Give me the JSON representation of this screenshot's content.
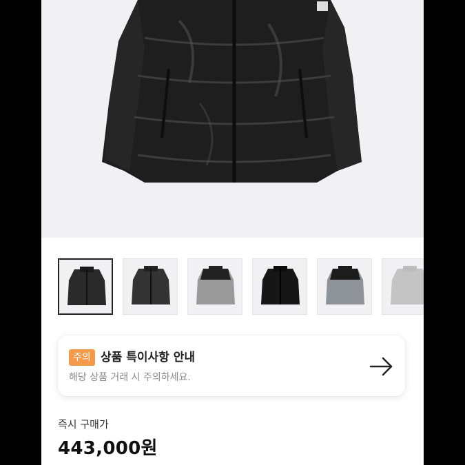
{
  "product": {
    "main_image": "black puffer down jacket",
    "thumbnails": [
      {
        "icon": "black-jacket",
        "color": "#2a2a2a",
        "accent": "#1a1a1a",
        "selected": true
      },
      {
        "icon": "black-jacket",
        "color": "#333333",
        "accent": "#222222",
        "selected": false
      },
      {
        "icon": "grey-black-jacket",
        "color": "#9a9a9a",
        "accent": "#222222",
        "selected": false
      },
      {
        "icon": "black-jacket",
        "color": "#161616",
        "accent": "#0e0e0e",
        "selected": false
      },
      {
        "icon": "grey-black-jacket",
        "color": "#8e939a",
        "accent": "#1c1c1c",
        "selected": false
      },
      {
        "icon": "silver-jacket",
        "color": "#c4c4c4",
        "accent": "#bdbdbd",
        "selected": false
      }
    ]
  },
  "notice": {
    "badge": "주의",
    "title": "상품 특이사항 안내",
    "subtitle": "해당 상품 거래 시 주의하세요.",
    "arrow_icon": "arrow-right-icon"
  },
  "purchase": {
    "label": "즉시 구매가",
    "price": "443,000원"
  },
  "colors": {
    "badge": "#f2994a",
    "background": "#f1f1f3"
  }
}
